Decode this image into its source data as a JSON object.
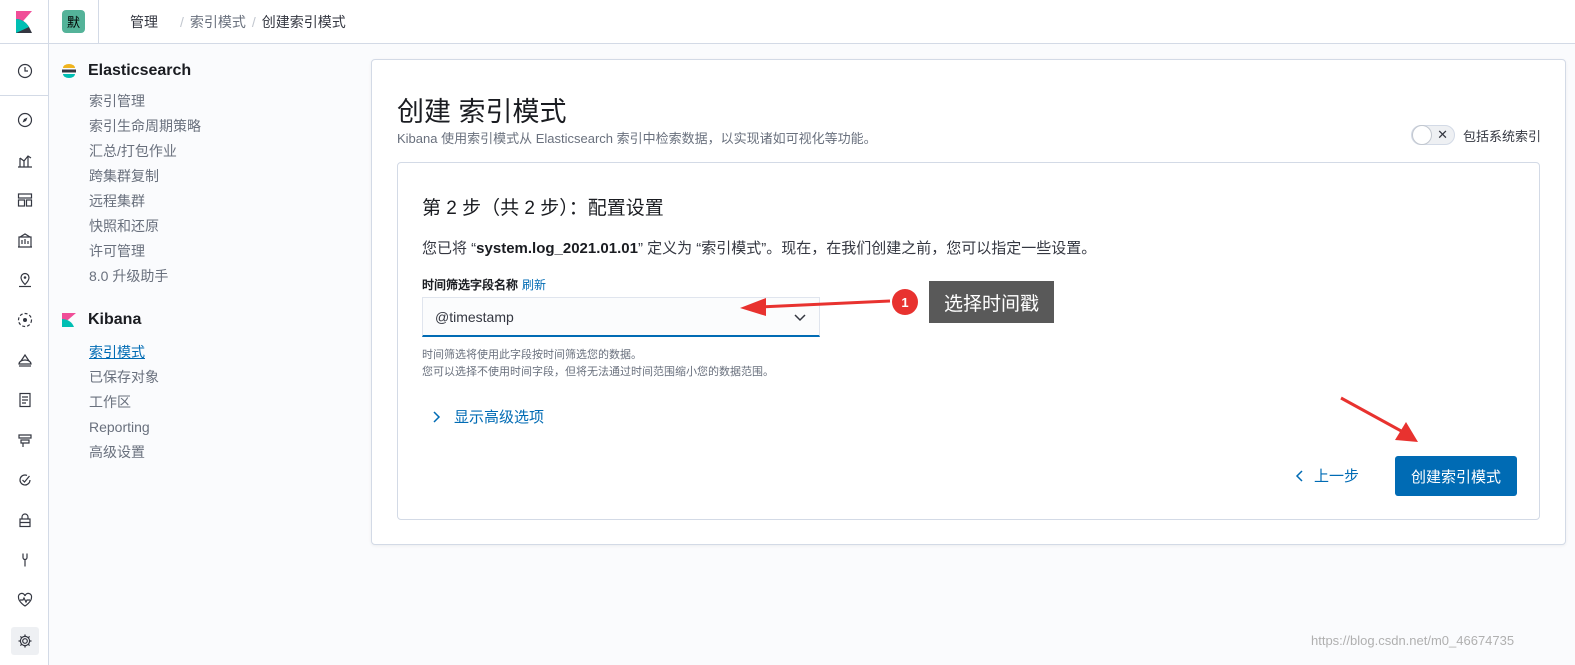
{
  "topbar": {
    "space_initial": "默",
    "breadcrumbs": [
      "管理",
      "索引模式",
      "创建索引模式"
    ]
  },
  "sidebar": {
    "groups": [
      {
        "title": "Elasticsearch",
        "items": [
          "索引管理",
          "索引生命周期策略",
          "汇总/打包作业",
          "跨集群复制",
          "远程集群",
          "快照和还原",
          "许可管理",
          "8.0 升级助手"
        ]
      },
      {
        "title": "Kibana",
        "items": [
          "索引模式",
          "已保存对象",
          "工作区",
          "Reporting",
          "高级设置"
        ],
        "active": "索引模式"
      }
    ]
  },
  "page": {
    "title": "创建 索引模式",
    "description": "Kibana 使用索引模式从 Elasticsearch 索引中检索数据，以实现诸如可视化等功能。",
    "toggle_label": "包括系统索引",
    "toggle_on": false
  },
  "step": {
    "title": "第 2 步（共 2 步）：配置设置",
    "desc_prefix": "您已将 “",
    "index_name": "system.log_2021.01.01",
    "desc_suffix": "” 定义为 “索引模式”。现在，在我们创建之前，您可以指定一些设置。",
    "field_label": "时间筛选字段名称",
    "refresh_label": "刷新",
    "selected_field": "@timestamp",
    "help_line1": "时间筛选将使用此字段按时间筛选您的数据。",
    "help_line2": "您可以选择不使用时间字段，但将无法通过时间范围缩小您的数据范围。",
    "advanced_label": "显示高级选项",
    "back_label": "上一步",
    "create_label": "创建索引模式"
  },
  "annotation": {
    "number": "1",
    "text": "选择时间戳"
  },
  "watermark": "https://blog.csdn.net/m0_46674735",
  "colors": {
    "primary": "#006bb4",
    "annotation_red": "#e8322f",
    "annotation_box": "#595959"
  }
}
